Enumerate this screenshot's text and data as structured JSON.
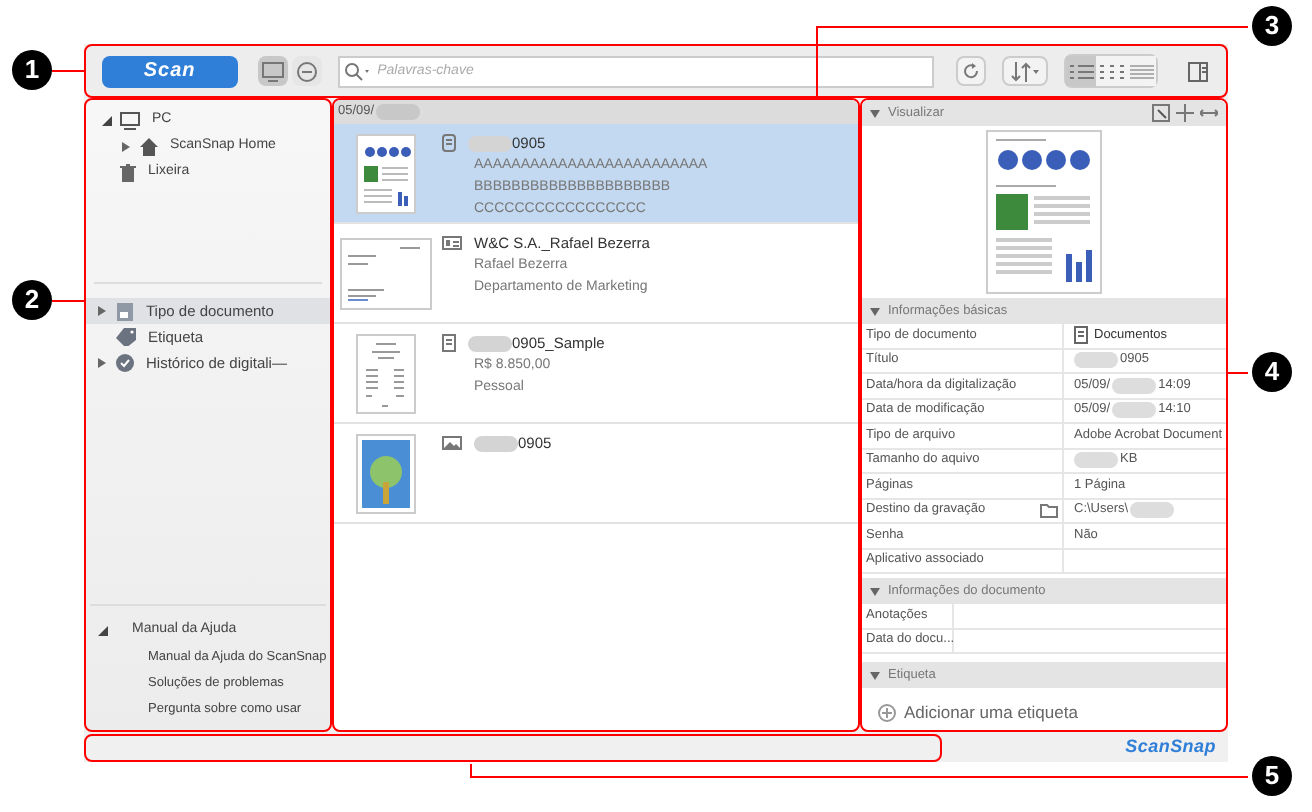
{
  "callouts": [
    {
      "number": "1"
    },
    {
      "number": "2"
    },
    {
      "number": "3"
    },
    {
      "number": "4"
    },
    {
      "number": "5"
    }
  ],
  "toolbar": {
    "scan_button": "Scan",
    "source_toggle": [
      {
        "selected": true
      },
      {
        "selected": false
      }
    ],
    "search": {
      "placeholder": "Palavras-chave"
    },
    "view_modes": [
      {
        "selected": true
      },
      {
        "selected": false
      },
      {
        "selected": false
      }
    ]
  },
  "sidebar": {
    "tree": [
      {
        "label": "PC",
        "kind": "computer",
        "expanded": true,
        "children": [
          {
            "label": "ScanSnap Home",
            "kind": "home",
            "expanded": false
          }
        ]
      },
      {
        "label": "Lixeira",
        "kind": "trash"
      }
    ],
    "categories": [
      {
        "label": "Tipo de documento",
        "kind": "doctype",
        "selected": true,
        "expandable": true
      },
      {
        "label": "Etiqueta",
        "kind": "tag",
        "selected": false,
        "expandable": false
      },
      {
        "label": "Histórico de digitali—",
        "kind": "history",
        "selected": false,
        "expandable": true
      }
    ],
    "help": {
      "label": "Manual da Ajuda",
      "expanded": true,
      "items": [
        "Manual da Ajuda do ScanSnap",
        "Soluções de problemas",
        "Pergunta sobre como usar"
      ]
    }
  },
  "list": {
    "date_header": [
      {
        "kind": "text",
        "text": "05/09/"
      },
      {
        "kind": "redacted"
      }
    ],
    "items": [
      {
        "kind": "document",
        "selected": true,
        "title": [
          {
            "kind": "redacted"
          },
          {
            "kind": "text",
            "text": "0905"
          }
        ],
        "lines": [
          "AAAAAAAAAAAAAAAAAAAAAAAAA",
          "BBBBBBBBBBBBBBBBBBBBB",
          "CCCCCCCCCCCCCCCCC"
        ]
      },
      {
        "kind": "card",
        "selected": false,
        "title": [
          {
            "kind": "text",
            "text": "W&C S.A._Rafael Bezerra"
          }
        ],
        "lines": [
          "Rafael Bezerra",
          "Departamento de Marketing"
        ]
      },
      {
        "kind": "receipt",
        "selected": false,
        "title": [
          {
            "kind": "redacted"
          },
          {
            "kind": "text",
            "text": "0905_Sample"
          }
        ],
        "lines": [
          "R$ 8.850,00",
          "Pessoal"
        ]
      },
      {
        "kind": "photo",
        "selected": false,
        "title": [
          {
            "kind": "redacted"
          },
          {
            "kind": "text",
            "text": "0905"
          }
        ]
      }
    ]
  },
  "details": {
    "preview": {
      "title": "Visualizar"
    },
    "basic": {
      "title": "Informações básicas",
      "rows": [
        {
          "label": "Tipo de documento",
          "value": [
            {
              "kind": "text",
              "text": "Documentos"
            }
          ]
        },
        {
          "label": "Título",
          "value": [
            {
              "kind": "redacted"
            },
            {
              "kind": "text",
              "text": "0905"
            }
          ]
        },
        {
          "label": "Data/hora da digitalização",
          "value": [
            {
              "kind": "text",
              "text": "05/09/"
            },
            {
              "kind": "redacted"
            },
            {
              "kind": "text",
              "text": "14:09"
            }
          ]
        },
        {
          "label": "Data de modificação",
          "value": [
            {
              "kind": "text",
              "text": "05/09/"
            },
            {
              "kind": "redacted"
            },
            {
              "kind": "text",
              "text": "14:10"
            }
          ]
        },
        {
          "label": "Tipo de arquivo",
          "value": [
            {
              "kind": "text",
              "text": "Adobe Acrobat Document"
            }
          ]
        },
        {
          "label": "Tamanho do aquivo",
          "value": [
            {
              "kind": "redacted"
            },
            {
              "kind": "text",
              "text": "KB"
            }
          ]
        },
        {
          "label": "Páginas",
          "value": [
            {
              "kind": "text",
              "text": "1 Página"
            }
          ]
        },
        {
          "label": "Destino da gravação",
          "value": [
            {
              "kind": "text",
              "text": "C:\\Users\\"
            },
            {
              "kind": "redacted"
            }
          ]
        },
        {
          "label": "Senha",
          "value": [
            {
              "kind": "text",
              "text": "Não"
            }
          ]
        },
        {
          "label": "Aplicativo associado",
          "value": []
        }
      ]
    },
    "document": {
      "title": "Informações do documento",
      "rows": [
        {
          "label": "Anotações",
          "value": []
        },
        {
          "label": "Data do docu...",
          "value": []
        }
      ]
    },
    "tag": {
      "title": "Etiqueta",
      "add_button": "Adicionar uma etiqueta"
    }
  },
  "status_bar": {
    "logo": "ScanSnap"
  }
}
